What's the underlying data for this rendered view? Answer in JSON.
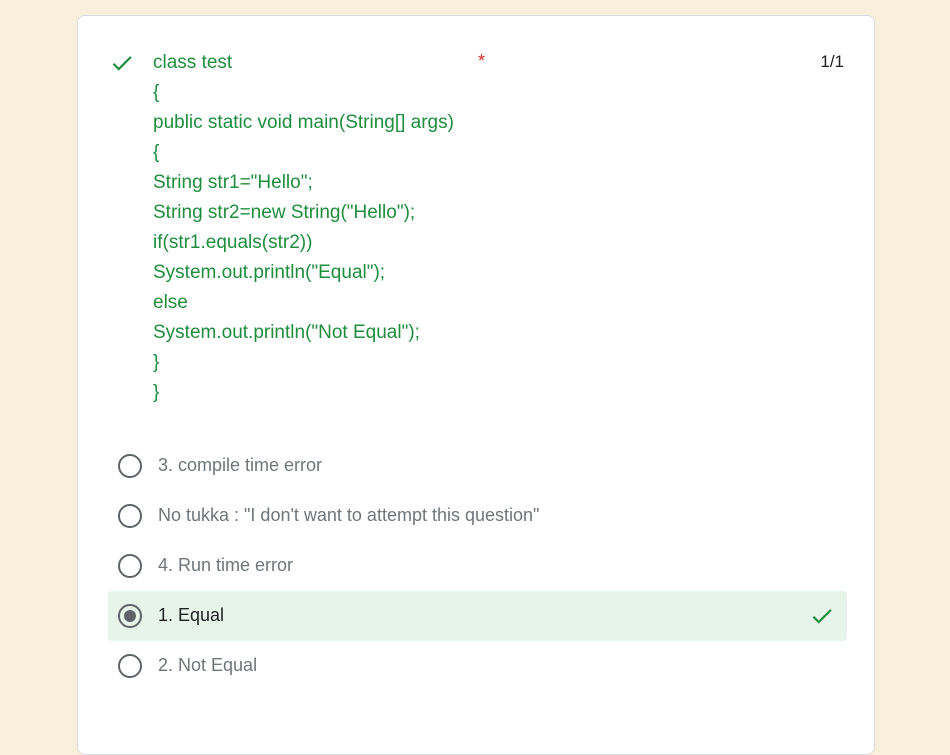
{
  "question": {
    "lines": [
      "class test",
      "{",
      "public static void main(String[] args)",
      "{",
      "String str1=\"Hello\";",
      "String str2=new String(\"Hello\");",
      "if(str1.equals(str2))",
      "System.out.println(\"Equal\");",
      "else",
      "System.out.println(\"Not Equal\");",
      "}",
      "}"
    ],
    "required_marker": "*",
    "score": "1/1",
    "status_icon": "check-icon"
  },
  "options": [
    {
      "label": "3. compile time error",
      "selected": false,
      "correct": false
    },
    {
      "label": "No tukka : \"I don't want to attempt this question\"",
      "selected": false,
      "correct": false
    },
    {
      "label": "4. Run time error",
      "selected": false,
      "correct": false
    },
    {
      "label": "1. Equal",
      "selected": true,
      "correct": true
    },
    {
      "label": "2. Not Equal",
      "selected": false,
      "correct": false
    }
  ],
  "colors": {
    "page_background": "#f8f0da",
    "correct_green": "#1e8e3e",
    "correct_highlight": "#e6f4ea",
    "required_red": "#d93025"
  }
}
